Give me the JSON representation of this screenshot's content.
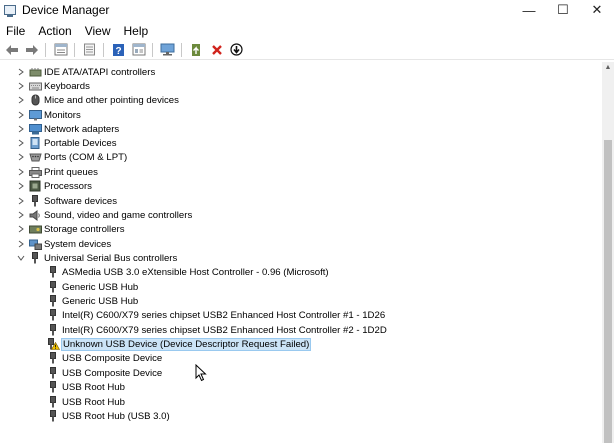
{
  "window": {
    "title": "Device Manager"
  },
  "window_controls": {
    "minimize": "—",
    "maximize": "☐",
    "close": "✕"
  },
  "menu": [
    "File",
    "Action",
    "View",
    "Help"
  ],
  "toolbar_icons": [
    "back-arrow-icon",
    "forward-arrow-icon",
    "show-hide-tree-icon",
    "properties-icon",
    "help-icon",
    "view-icon",
    "monitor-scan-icon",
    "update-driver-icon",
    "uninstall-device-icon",
    "disable-device-icon"
  ],
  "tree": {
    "categories": [
      {
        "label": "IDE ATA/ATAPI controllers",
        "icon": "ide-controller-icon"
      },
      {
        "label": "Keyboards",
        "icon": "keyboard-icon"
      },
      {
        "label": "Mice and other pointing devices",
        "icon": "mouse-icon"
      },
      {
        "label": "Monitors",
        "icon": "monitor-icon"
      },
      {
        "label": "Network adapters",
        "icon": "network-adapter-icon"
      },
      {
        "label": "Portable Devices",
        "icon": "portable-device-icon"
      },
      {
        "label": "Ports (COM & LPT)",
        "icon": "port-icon"
      },
      {
        "label": "Print queues",
        "icon": "printer-icon"
      },
      {
        "label": "Processors",
        "icon": "processor-icon"
      },
      {
        "label": "Software devices",
        "icon": "software-device-icon"
      },
      {
        "label": "Sound, video and game controllers",
        "icon": "speaker-icon"
      },
      {
        "label": "Storage controllers",
        "icon": "storage-controller-icon"
      },
      {
        "label": "System devices",
        "icon": "system-device-icon"
      },
      {
        "label": "Universal Serial Bus controllers",
        "icon": "usb-controller-icon"
      }
    ],
    "usb_children": [
      {
        "label": "ASMedia USB 3.0 eXtensible Host Controller - 0.96 (Microsoft)",
        "warning": false
      },
      {
        "label": "Generic USB Hub",
        "warning": false
      },
      {
        "label": "Generic USB Hub",
        "warning": false
      },
      {
        "label": "Intel(R) C600/X79 series chipset USB2 Enhanced Host Controller #1 - 1D26",
        "warning": false
      },
      {
        "label": "Intel(R) C600/X79 series chipset USB2 Enhanced Host Controller #2 - 1D2D",
        "warning": false
      },
      {
        "label": "Unknown USB Device (Device Descriptor Request Failed)",
        "warning": true,
        "selected": true
      },
      {
        "label": "USB Composite Device",
        "warning": false
      },
      {
        "label": "USB Composite Device",
        "warning": false
      },
      {
        "label": "USB Root Hub",
        "warning": false
      },
      {
        "label": "USB Root Hub",
        "warning": false
      },
      {
        "label": "USB Root Hub (USB 3.0)",
        "warning": false
      }
    ]
  },
  "colors": {
    "selection": "#cce4f7",
    "selection_border": "#99c9ef",
    "warning": "#f2c200"
  }
}
